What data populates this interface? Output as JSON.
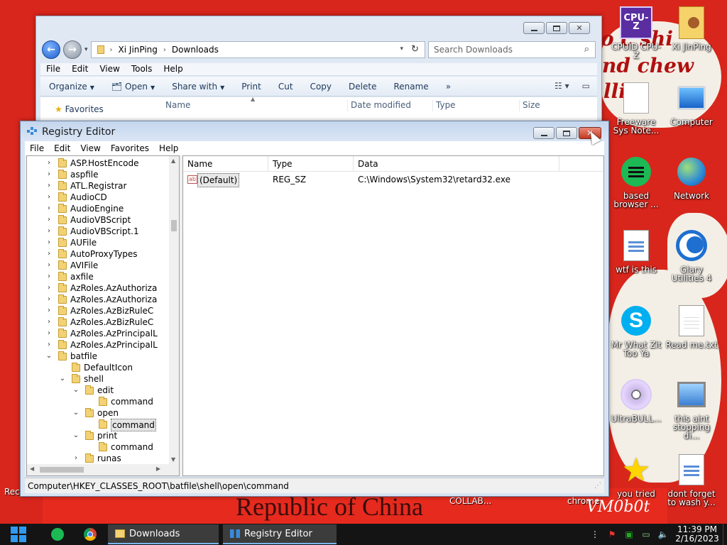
{
  "desktop": {
    "background_texts": {
      "top_line1": "o c shi",
      "top_line2": "nd chew",
      "top_line3": "llin",
      "banner": "Republic of China",
      "collab": "COLLAB...",
      "chrome": "chrome",
      "watermark": "VM0b0t",
      "rec": "Rec"
    },
    "icons": [
      {
        "id": "cpuz",
        "label": "CPUID CPU-Z",
        "icon": "cpuz-icon"
      },
      {
        "id": "xi",
        "label": "Xi JinPing",
        "icon": "user-folder-icon"
      },
      {
        "id": "freeware",
        "label": "Freeware Sys Note...",
        "icon": "blank-doc-icon"
      },
      {
        "id": "computer",
        "label": "Computer",
        "icon": "computer-icon"
      },
      {
        "id": "based",
        "label": "based browser ...",
        "icon": "green-chat-icon"
      },
      {
        "id": "network",
        "label": "Network",
        "icon": "network-icon"
      },
      {
        "id": "wtf",
        "label": "wtf is this",
        "icon": "document-icon"
      },
      {
        "id": "glary",
        "label": "Glary Utilities 4",
        "icon": "glary-icon"
      },
      {
        "id": "skype",
        "label": "Mr What Zit Too Ya",
        "icon": "skype-icon"
      },
      {
        "id": "readme",
        "label": "Read me.txt",
        "icon": "text-file-icon"
      },
      {
        "id": "ultrabull",
        "label": "UltraBULL...",
        "icon": "disc-icon"
      },
      {
        "id": "aint",
        "label": "this aint stopping di...",
        "icon": "pc-setup-icon"
      },
      {
        "id": "youtried",
        "label": "you tried",
        "icon": "star-icon"
      },
      {
        "id": "dontforget",
        "label": "dont forget to wash y...",
        "icon": "document-icon"
      }
    ]
  },
  "explorer": {
    "address": {
      "seg1": "Xi JinPing",
      "seg2": "Downloads"
    },
    "search_placeholder": "Search Downloads",
    "menu": [
      "File",
      "Edit",
      "View",
      "Tools",
      "Help"
    ],
    "toolbar": {
      "organize": "Organize",
      "open": "Open",
      "share": "Share with",
      "print": "Print",
      "cut": "Cut",
      "copy": "Copy",
      "delete": "Delete",
      "rename": "Rename",
      "more": "»"
    },
    "nav": {
      "favorites": "Favorites"
    },
    "columns": {
      "name": "Name",
      "date": "Date modified",
      "type": "Type",
      "size": "Size"
    }
  },
  "regedit": {
    "title": "Registry Editor",
    "menu": [
      "File",
      "Edit",
      "View",
      "Favorites",
      "Help"
    ],
    "tree": [
      {
        "label": "ASP.HostEncode",
        "level": 0,
        "arrow": ">"
      },
      {
        "label": "aspfile",
        "level": 0,
        "arrow": ">"
      },
      {
        "label": "ATL.Registrar",
        "level": 0,
        "arrow": ">"
      },
      {
        "label": "AudioCD",
        "level": 0,
        "arrow": ">"
      },
      {
        "label": "AudioEngine",
        "level": 0,
        "arrow": ">"
      },
      {
        "label": "AudioVBScript",
        "level": 0,
        "arrow": ">"
      },
      {
        "label": "AudioVBScript.1",
        "level": 0,
        "arrow": ">"
      },
      {
        "label": "AUFile",
        "level": 0,
        "arrow": ">"
      },
      {
        "label": "AutoProxyTypes",
        "level": 0,
        "arrow": ">"
      },
      {
        "label": "AVIFile",
        "level": 0,
        "arrow": ">"
      },
      {
        "label": "axfile",
        "level": 0,
        "arrow": ">"
      },
      {
        "label": "AzRoles.AzAuthoriza",
        "level": 0,
        "arrow": ">"
      },
      {
        "label": "AzRoles.AzAuthoriza",
        "level": 0,
        "arrow": ">"
      },
      {
        "label": "AzRoles.AzBizRuleC",
        "level": 0,
        "arrow": ">"
      },
      {
        "label": "AzRoles.AzBizRuleC",
        "level": 0,
        "arrow": ">"
      },
      {
        "label": "AzRoles.AzPrincipalL",
        "level": 0,
        "arrow": ">"
      },
      {
        "label": "AzRoles.AzPrincipalL",
        "level": 0,
        "arrow": ">"
      },
      {
        "label": "batfile",
        "level": 0,
        "arrow": "v"
      },
      {
        "label": "DefaultIcon",
        "level": 1,
        "arrow": ""
      },
      {
        "label": "shell",
        "level": 1,
        "arrow": "v"
      },
      {
        "label": "edit",
        "level": 2,
        "arrow": "v"
      },
      {
        "label": "command",
        "level": 3,
        "arrow": ""
      },
      {
        "label": "open",
        "level": 2,
        "arrow": "v"
      },
      {
        "label": "command",
        "level": 3,
        "arrow": "",
        "selected": true
      },
      {
        "label": "print",
        "level": 2,
        "arrow": "v"
      },
      {
        "label": "command",
        "level": 3,
        "arrow": ""
      },
      {
        "label": "runas",
        "level": 2,
        "arrow": ">"
      }
    ],
    "columns": {
      "name": "Name",
      "type": "Type",
      "data": "Data"
    },
    "values": [
      {
        "name": "(Default)",
        "type": "REG_SZ",
        "data": "C:\\Windows\\System32\\retard32.exe"
      }
    ],
    "status_path": "Computer\\HKEY_CLASSES_ROOT\\batfile\\shell\\open\\command"
  },
  "taskbar": {
    "tasks": {
      "downloads": "Downloads",
      "regedit": "Registry Editor"
    },
    "clock": {
      "time": "11:39 PM",
      "date": "2/16/2023"
    }
  }
}
